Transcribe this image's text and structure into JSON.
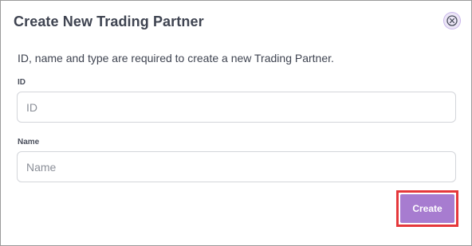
{
  "dialog": {
    "title": "Create New Trading Partner",
    "close_icon": "close-icon",
    "description": "ID, name and type are required to create a new Trading Partner."
  },
  "fields": {
    "id": {
      "label": "ID",
      "placeholder": "ID",
      "value": ""
    },
    "name": {
      "label": "Name",
      "placeholder": "Name",
      "value": ""
    }
  },
  "actions": {
    "create_label": "Create"
  },
  "colors": {
    "accent": "#a77cd0",
    "highlight": "#e5383b",
    "text": "#3f4451"
  }
}
